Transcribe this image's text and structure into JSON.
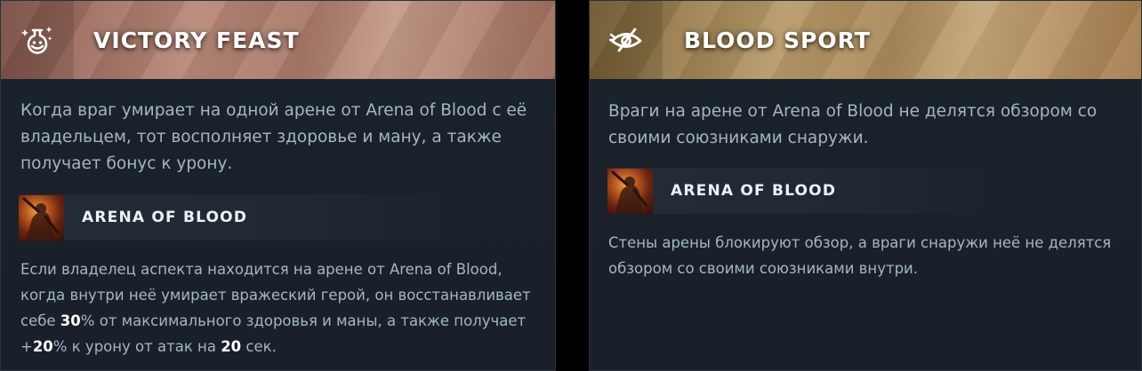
{
  "cards": [
    {
      "title": "VICTORY FEAST",
      "icon": "potion-sparkle-icon",
      "description": "Когда враг умирает на одной арене от Arena of Blood с её владельцем, тот восполняет здоровье и ману, а также получает бонус к урону.",
      "ability": {
        "name": "ARENA OF BLOOD",
        "icon": "arena-of-blood-icon"
      },
      "details": {
        "part1": "Если владелец аспекта находится на арене от Arena of Blood, когда внутри неё умирает вражеский герой, он восстанавливает себе ",
        "heal_value": "30",
        "part2": "% от максимального здоровья и маны, а также получает +",
        "damage_value": "20",
        "part3": "% к урону от атак на ",
        "duration_value": "20",
        "part4": " сек."
      }
    },
    {
      "title": "BLOOD SPORT",
      "icon": "blind-eye-icon",
      "description": "Враги на арене от Arena of Blood не делятся обзором со своими союзниками снаружи.",
      "ability": {
        "name": "ARENA OF BLOOD",
        "icon": "arena-of-blood-icon"
      },
      "details": "Стены арены блокируют обзор, а враги снаружи неё не делятся обзором со своими союзниками внутри."
    }
  ],
  "colors": {
    "panel_bg": "#1b222b",
    "text_muted": "#a3b6c7",
    "text_highlight": "#ffffff",
    "header_left_tint": "#b88878",
    "header_right_tint": "#b89a68"
  }
}
